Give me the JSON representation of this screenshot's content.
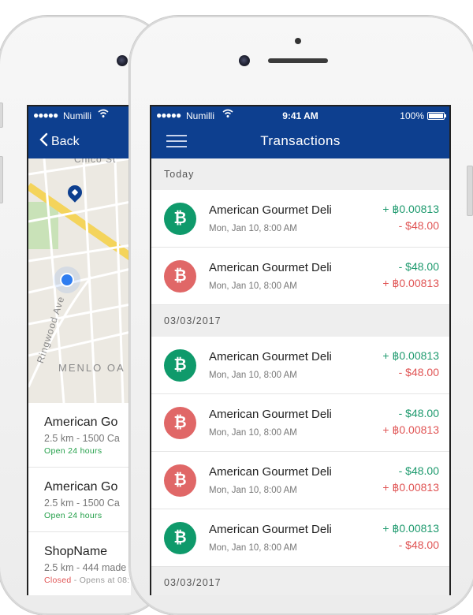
{
  "back_phone": {
    "status": {
      "signal": "●●●●●",
      "carrier": "Numilli"
    },
    "nav": {
      "back_label": "Back"
    },
    "map": {
      "street_top": "Chico St",
      "street_side": "Ringwood Ave",
      "area": "MENLO OA"
    },
    "places": [
      {
        "name": "American Go",
        "meta": "2.5 km - 1500 Ca",
        "hours": "Open 24 hours",
        "rest": ""
      },
      {
        "name": "American Go",
        "meta": "2.5 km - 1500 Ca",
        "hours": "Open 24 hours",
        "rest": ""
      },
      {
        "name": "ShopName",
        "meta": "2.5 km - 444 made",
        "hours": "Closed",
        "rest": " - Opens at 08:"
      }
    ]
  },
  "front_phone": {
    "status": {
      "signal": "●●●●●",
      "carrier": "Numilli",
      "time": "9:41 AM",
      "battery": "100%"
    },
    "nav": {
      "title": "Transactions"
    },
    "sections": [
      {
        "header": "Today",
        "rows": [
          {
            "coin": "₿",
            "coin_color": "green",
            "name": "American Gourmet Deli",
            "date": "Mon, Jan 10, 8:00 AM",
            "amt1": "+ ฿0.00813",
            "amt1_type": "pos",
            "amt2": "- $48.00",
            "amt2_type": "neg"
          },
          {
            "coin": "₿",
            "coin_color": "red",
            "name": "American Gourmet Deli",
            "date": "Mon, Jan 10, 8:00 AM",
            "amt1": "- $48.00",
            "amt1_type": "pos",
            "amt2": "+ ฿0.00813",
            "amt2_type": "neg"
          }
        ]
      },
      {
        "header": "03/03/2017",
        "rows": [
          {
            "coin": "₿",
            "coin_color": "green",
            "name": "American Gourmet Deli",
            "date": "Mon, Jan 10, 8:00 AM",
            "amt1": "+ ฿0.00813",
            "amt1_type": "pos",
            "amt2": "- $48.00",
            "amt2_type": "neg"
          },
          {
            "coin": "₿",
            "coin_color": "red",
            "name": "American Gourmet Deli",
            "date": "Mon, Jan 10, 8:00 AM",
            "amt1": "- $48.00",
            "amt1_type": "pos",
            "amt2": "+ ฿0.00813",
            "amt2_type": "neg"
          },
          {
            "coin": "₿",
            "coin_color": "red",
            "name": "American Gourmet Deli",
            "date": "Mon, Jan 10, 8:00 AM",
            "amt1": "- $48.00",
            "amt1_type": "pos",
            "amt2": "+ ฿0.00813",
            "amt2_type": "neg"
          },
          {
            "coin": "₿",
            "coin_color": "green",
            "name": "American Gourmet Deli",
            "date": "Mon, Jan 10, 8:00 AM",
            "amt1": "+ ฿0.00813",
            "amt1_type": "pos",
            "amt2": "- $48.00",
            "amt2_type": "neg"
          }
        ]
      },
      {
        "header": "03/03/2017",
        "rows": []
      }
    ]
  },
  "colors": {
    "nav_blue": "#0d3f8f",
    "positive": "#1e9a6e",
    "negative": "#e05454",
    "coin_green": "#0f9a6b",
    "coin_red": "#e06767"
  }
}
